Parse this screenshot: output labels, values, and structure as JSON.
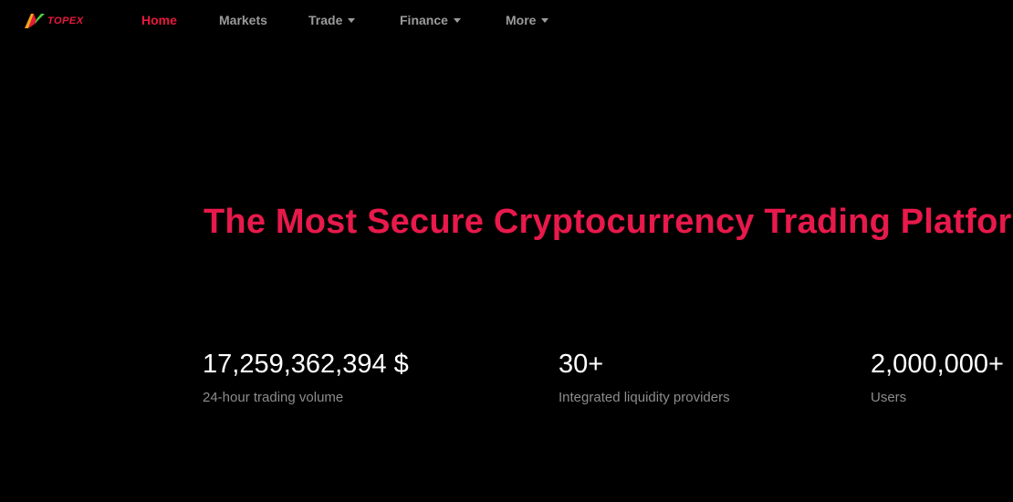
{
  "brand": {
    "logo_text": "TOPEX"
  },
  "nav": {
    "home": "Home",
    "markets": "Markets",
    "trade": "Trade",
    "finance": "Finance",
    "more": "More"
  },
  "hero": {
    "title": "The Most Secure Cryptocurrency Trading Platform"
  },
  "stats": [
    {
      "value": "17,259,362,394 $",
      "label": "24-hour trading volume"
    },
    {
      "value": "30+",
      "label": "Integrated liquidity providers"
    },
    {
      "value": "2,000,000+",
      "label": "Users"
    }
  ],
  "colors": {
    "accent": "#e8193c",
    "nav_text": "#9b9b9b",
    "background": "#000000"
  }
}
